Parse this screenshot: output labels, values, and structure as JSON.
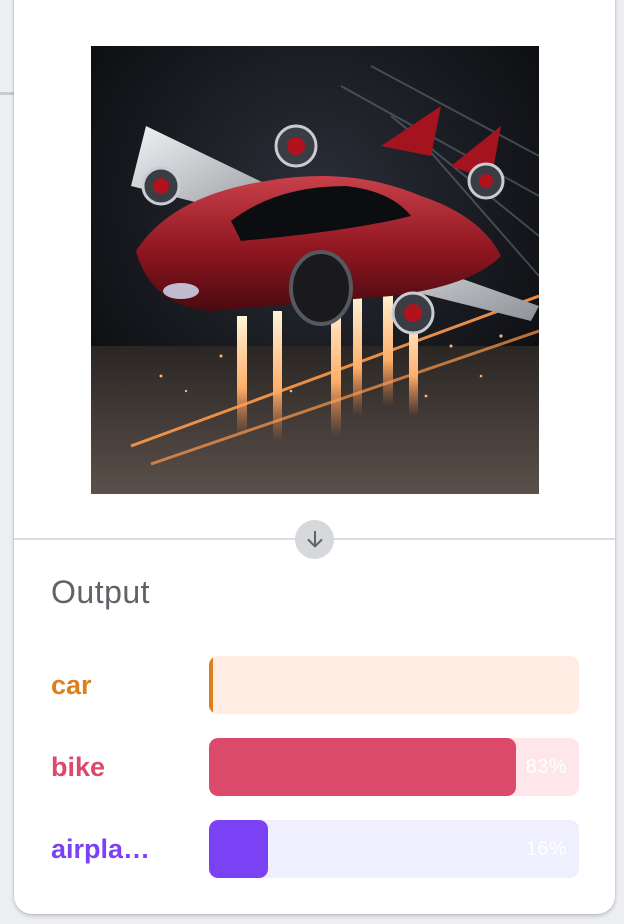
{
  "output": {
    "title": "Output",
    "results": [
      {
        "label": "car",
        "value_text": "",
        "fraction": 0.01,
        "color": "#dd7f1f",
        "track_color": "#ffede3"
      },
      {
        "label": "bike",
        "value_text": "83%",
        "fraction": 0.83,
        "color": "#db4a6a",
        "track_color": "#ffe6ea"
      },
      {
        "label": "airpla…",
        "value_text": "16%",
        "fraction": 0.16,
        "color": "#7a42f4",
        "track_color": "#efefff"
      }
    ]
  },
  "icons": {
    "divider_arrow": "arrow-down-icon"
  },
  "colors": {
    "title": "#5f6368",
    "divider_circle": "#d6d8db"
  }
}
